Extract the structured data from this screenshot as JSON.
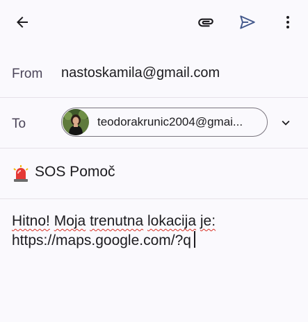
{
  "toolbar": {
    "back_icon": "arrow-back-icon",
    "attach_icon": "paperclip-icon",
    "send_icon": "send-icon",
    "more_icon": "more-vert-icon"
  },
  "from": {
    "label": "From",
    "value": "nastoskamila@gmail.com"
  },
  "to": {
    "label": "To",
    "recipient_chip": "teodorakrunic2004@gmai...",
    "avatar": "avatar-photo",
    "expand_icon": "chevron-down-icon"
  },
  "subject": {
    "emoji_icon": "siren-icon",
    "value": "SOS Pomoč"
  },
  "body": {
    "words": [
      "Hitno!",
      "Moja",
      "trenutna",
      "lokacija",
      "je:"
    ],
    "line2": "https://maps.google.com/?q"
  },
  "colors": {
    "background": "#faf9fd",
    "send_accent": "#44598c",
    "divider": "#e6e1e8",
    "spellcheck": "#d93025"
  }
}
